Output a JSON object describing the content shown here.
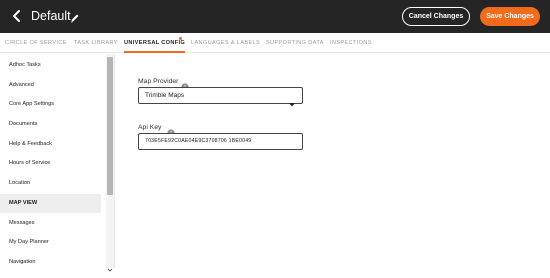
{
  "header": {
    "title": "Default",
    "cancel_label": "Cancel Changes",
    "save_label": "Save Changes"
  },
  "tabs": [
    {
      "label": "CIRCLE OF SERVICE",
      "active": false
    },
    {
      "label": "TASK LIBRARY",
      "active": false
    },
    {
      "label": "UNIVERSAL CONFIG",
      "active": true,
      "indicator": true
    },
    {
      "label": "LANGUAGES & LABELS",
      "active": false
    },
    {
      "label": "SUPPORTING DATA",
      "active": false
    },
    {
      "label": "INSPECTIONS",
      "active": false
    }
  ],
  "sidebar": {
    "items": [
      {
        "label": "Adhoc Tasks"
      },
      {
        "label": "Advanced"
      },
      {
        "label": "Core App Settings"
      },
      {
        "label": "Documents"
      },
      {
        "label": "Help & Feedback"
      },
      {
        "label": "Hours of Service"
      },
      {
        "label": "Location"
      },
      {
        "label": "MAP VIEW",
        "active": true
      },
      {
        "label": "Messages"
      },
      {
        "label": "My Day Planner"
      },
      {
        "label": "Navigation"
      }
    ]
  },
  "main": {
    "map_provider": {
      "label": "Map Provider",
      "value": "Trimble Maps"
    },
    "api_key": {
      "label": "Api Key",
      "value": "703E5FE92C0AE04E9C3708706 1BE0049"
    }
  },
  "colors": {
    "header_bg": "#252525",
    "accent": "#f26a1b",
    "active_item_bg": "#eeeeee"
  },
  "icons": {
    "back": "chevron-left-icon",
    "edit": "pencil-icon",
    "info": "info-icon",
    "dropdown": "caret-down-icon",
    "scroll": "chevron-down-icon"
  }
}
